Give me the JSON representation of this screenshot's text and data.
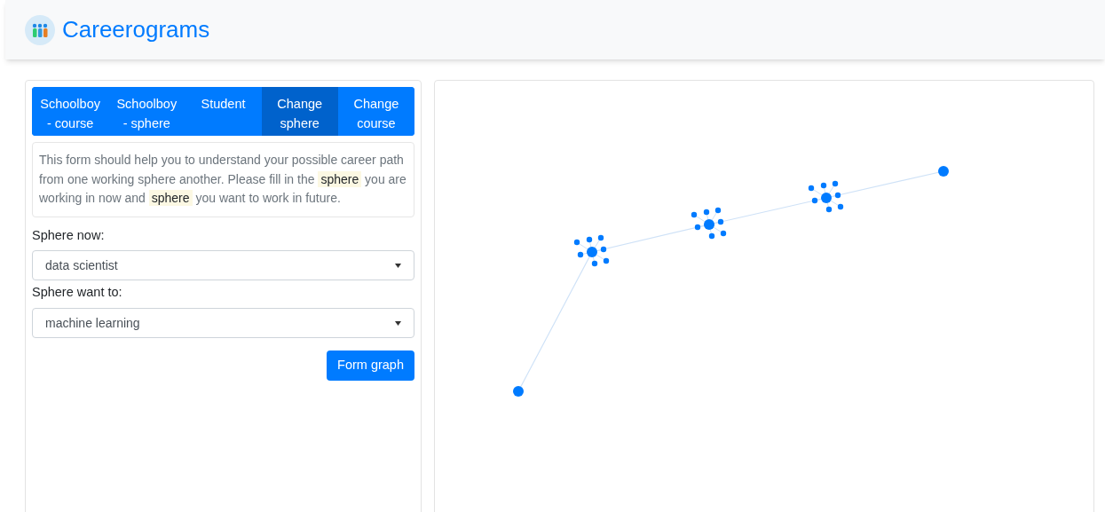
{
  "brand": {
    "title": "Careerograms"
  },
  "tabs": [
    {
      "label": "Schoolboy - course",
      "selected": false
    },
    {
      "label": "Schoolboy - sphere",
      "selected": false
    },
    {
      "label": "Student",
      "selected": false
    },
    {
      "label": "Change sphere",
      "selected": true
    },
    {
      "label": "Change course",
      "selected": false
    }
  ],
  "description": [
    {
      "text": "This form should help you to understand your possible career path from one working sphere another. Please fill in the ",
      "highlighted": false
    },
    {
      "text": "sphere",
      "highlighted": true
    },
    {
      "text": " you are working in now and ",
      "highlighted": false
    },
    {
      "text": "sphere",
      "highlighted": true
    },
    {
      "text": " you want to work in future.",
      "highlighted": false
    }
  ],
  "fields": [
    {
      "label": "Sphere now:",
      "value": "data scientist"
    },
    {
      "label": "Sphere want to:",
      "value": "machine learning"
    }
  ],
  "submit": {
    "label": "Form graph"
  }
}
